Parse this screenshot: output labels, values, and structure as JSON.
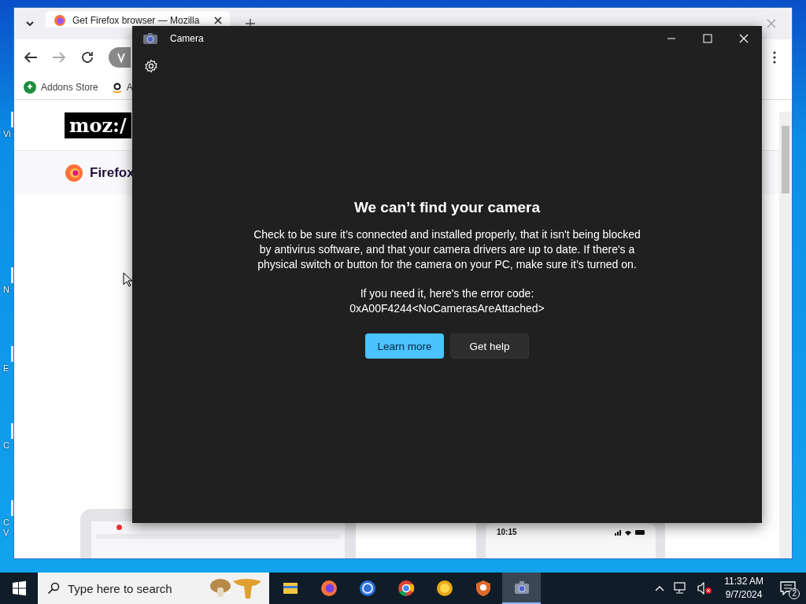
{
  "desktop": {
    "icons": [
      {
        "lines": [
          "Vi"
        ]
      },
      {
        "lines": [
          "N"
        ]
      },
      {
        "lines": [
          "E"
        ]
      },
      {
        "lines": [
          "C"
        ]
      },
      {
        "lines": [
          "C",
          "V"
        ]
      }
    ]
  },
  "browser": {
    "tabs": [
      {
        "title": "Get Firefox browser — Mozilla",
        "selected": true
      }
    ],
    "bookmarks": [
      {
        "label": "Addons Store",
        "kind": "addons"
      },
      {
        "label": "A",
        "kind": "amazon"
      }
    ],
    "page": {
      "logo": "moz:/",
      "product": "Firefox",
      "phone_time": "10:15"
    }
  },
  "camera": {
    "title": "Camera",
    "heading": "We can’t find your camera",
    "message": "Check to be sure it’s connected and installed properly, that it isn't being blocked by antivirus software, and that your camera drivers are up to date. If there's a physical switch or button for the camera on your PC, make sure it’s turned on.",
    "error_intro": "If you need it, here's the error code:",
    "error_code": "0xA00F4244<NoCamerasAreAttached>",
    "buttons": [
      {
        "label": "Learn more",
        "kind": "primary"
      },
      {
        "label": "Get help",
        "kind": "secondary"
      }
    ]
  },
  "taskbar": {
    "search": {
      "placeholder": "Type here to search"
    },
    "apps": [
      {
        "kind": "folder",
        "selected": false
      },
      {
        "kind": "firefox",
        "selected": false
      },
      {
        "kind": "bluering",
        "selected": false
      },
      {
        "kind": "chrome",
        "selected": false
      },
      {
        "kind": "yellow",
        "selected": false
      },
      {
        "kind": "shield",
        "selected": false
      },
      {
        "kind": "camera",
        "selected": true
      }
    ],
    "time": "11:32 AM",
    "date": "9/7/2024",
    "notifications": "2"
  }
}
